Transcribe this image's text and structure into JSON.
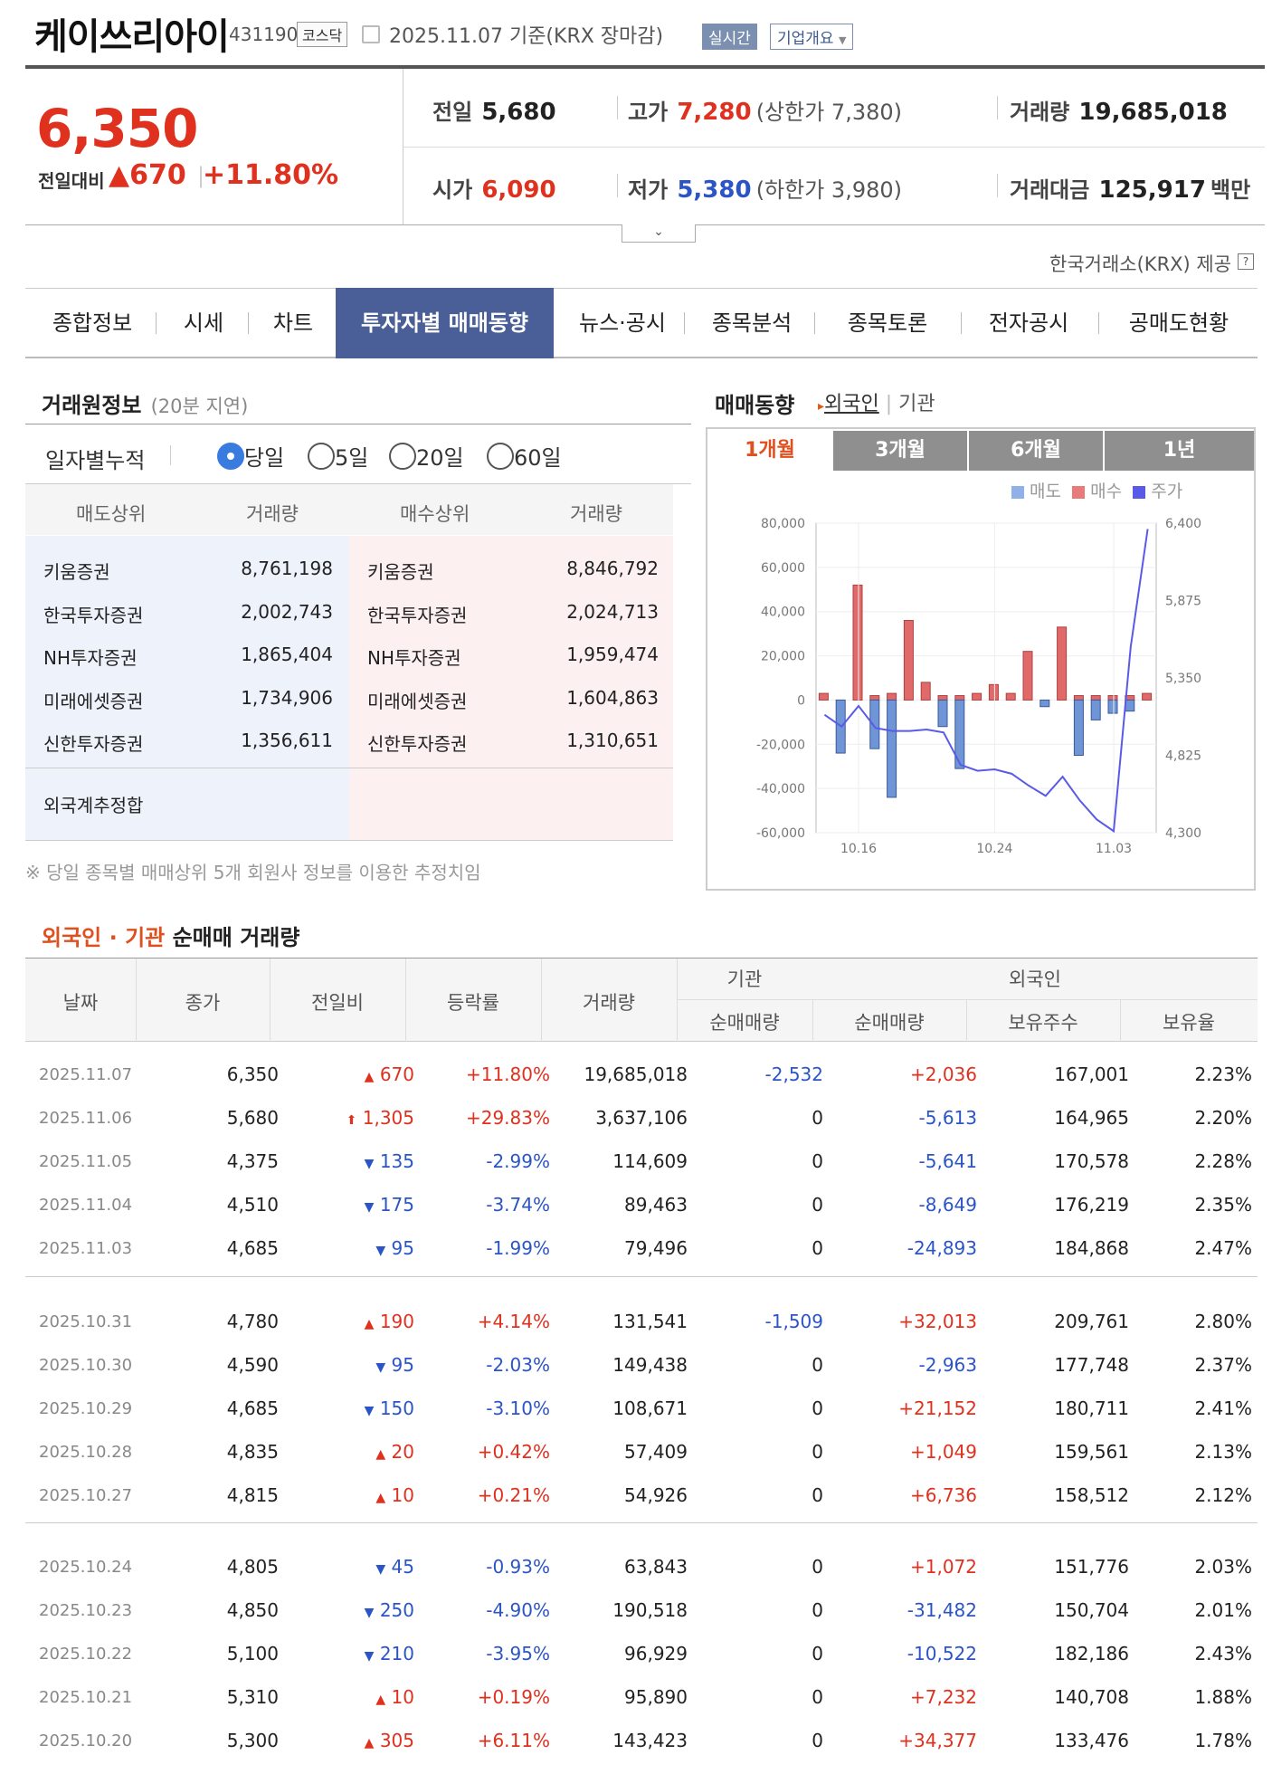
{
  "header": {
    "stock_name": "케이쓰리아이",
    "stock_code": "431190",
    "market": "코스닥",
    "date_basis": "2025.11.07 기준(KRX 장마감)",
    "realtime_label": "실시간",
    "company_label": "기업개요"
  },
  "quote": {
    "price": "6,350",
    "change_label": "전일대비",
    "change": "670",
    "change_pct": "+11.80%",
    "prev_label": "전일",
    "prev": "5,680",
    "high_label": "고가",
    "high": "7,280",
    "upper_limit": "(상한가 7,380)",
    "volume_label": "거래량",
    "volume": "19,685,018",
    "open_label": "시가",
    "open": "6,090",
    "low_label": "저가",
    "low": "5,380",
    "lower_limit": "(하한가 3,980)",
    "amount_label": "거래대금",
    "amount": "125,917",
    "amount_unit": "백만",
    "provider": "한국거래소(KRX) 제공"
  },
  "tabs": [
    "종합정보",
    "시세",
    "차트",
    "투자자별 매매동향",
    "뉴스·공시",
    "종목분석",
    "종목토론",
    "전자공시",
    "공매도현황"
  ],
  "broker": {
    "title": "거래원정보",
    "delay": "(20분 지연)",
    "period_label": "일자별누적",
    "periods": [
      "당일",
      "5일",
      "20일",
      "60일"
    ],
    "headers": [
      "매도상위",
      "거래량",
      "매수상위",
      "거래량"
    ],
    "sell": [
      {
        "name": "키움증권",
        "vol": "8,761,198"
      },
      {
        "name": "한국투자증권",
        "vol": "2,002,743"
      },
      {
        "name": "NH투자증권",
        "vol": "1,865,404"
      },
      {
        "name": "미래에셋증권",
        "vol": "1,734,906"
      },
      {
        "name": "신한투자증권",
        "vol": "1,356,611"
      }
    ],
    "buy": [
      {
        "name": "키움증권",
        "vol": "8,846,792"
      },
      {
        "name": "한국투자증권",
        "vol": "2,024,713"
      },
      {
        "name": "NH투자증권",
        "vol": "1,959,474"
      },
      {
        "name": "미래에셋증권",
        "vol": "1,604,863"
      },
      {
        "name": "신한투자증권",
        "vol": "1,310,651"
      }
    ],
    "foreign_total": "외국계추정합",
    "note": "※ 당일 종목별 매매상위 5개 회원사 정보를 이용한 추정치임"
  },
  "trend": {
    "title": "매매동향",
    "link_foreign": "외국인",
    "link_inst": "기관",
    "periods": [
      "1개월",
      "3개월",
      "6개월",
      "1년"
    ],
    "legend": [
      "매도",
      "매수",
      "주가"
    ]
  },
  "chart_data": {
    "type": "bar",
    "x_ticks": [
      "10.16",
      "10.24",
      "11.03"
    ],
    "left_ticks": [
      "80,000",
      "60,000",
      "40,000",
      "20,000",
      "0",
      "-20,000",
      "-40,000",
      "-60,000"
    ],
    "right_ticks": [
      "6,400",
      "5,875",
      "5,350",
      "4,825",
      "4,300"
    ],
    "ylim": [
      -60000,
      80000
    ],
    "y2lim": [
      4300,
      6400
    ],
    "sell": [
      0,
      -24000,
      0,
      -22000,
      -44000,
      0,
      0,
      -12000,
      -31000,
      0,
      0,
      0,
      0,
      -3000,
      0,
      -25000,
      -9000,
      -6000,
      -5000,
      0
    ],
    "buy": [
      3000,
      0,
      52000,
      2000,
      3000,
      36000,
      8000,
      2000,
      2000,
      3000,
      7000,
      3000,
      22000,
      0,
      33000,
      2000,
      2000,
      2000,
      2000,
      3000
    ],
    "price": [
      5100,
      5020,
      5160,
      5010,
      4990,
      4990,
      5000,
      4980,
      4760,
      4720,
      4730,
      4700,
      4620,
      4550,
      4680,
      4520,
      4390,
      4310,
      5560,
      6360
    ],
    "colors": {
      "sell": "#6f95d6",
      "buy": "#e06a6a",
      "price": "#5a5ae8"
    }
  },
  "net": {
    "title_red": "외국인 · 기관",
    "title_rest": "순매매 거래량",
    "headers": {
      "date": "날짜",
      "close": "종가",
      "diff": "전일비",
      "rate": "등락률",
      "volume": "거래량",
      "inst_group": "기관",
      "inst_net": "순매매량",
      "foreign_group": "외국인",
      "foreign_net": "순매매량",
      "foreign_hold": "보유주수",
      "foreign_ratio": "보유율"
    },
    "rows": [
      {
        "date": "2025.11.07",
        "close": "6,350",
        "dir": "up",
        "diff": "670",
        "rate": "+11.80%",
        "vol": "19,685,018",
        "inst": "-2,532",
        "fnet": "+2,036",
        "hold": "167,001",
        "ratio": "2.23%"
      },
      {
        "date": "2025.11.06",
        "close": "5,680",
        "dir": "upper",
        "diff": "1,305",
        "rate": "+29.83%",
        "vol": "3,637,106",
        "inst": "0",
        "fnet": "-5,613",
        "hold": "164,965",
        "ratio": "2.20%"
      },
      {
        "date": "2025.11.05",
        "close": "4,375",
        "dir": "down",
        "diff": "135",
        "rate": "-2.99%",
        "vol": "114,609",
        "inst": "0",
        "fnet": "-5,641",
        "hold": "170,578",
        "ratio": "2.28%"
      },
      {
        "date": "2025.11.04",
        "close": "4,510",
        "dir": "down",
        "diff": "175",
        "rate": "-3.74%",
        "vol": "89,463",
        "inst": "0",
        "fnet": "-8,649",
        "hold": "176,219",
        "ratio": "2.35%"
      },
      {
        "date": "2025.11.03",
        "close": "4,685",
        "dir": "down",
        "diff": "95",
        "rate": "-1.99%",
        "vol": "79,496",
        "inst": "0",
        "fnet": "-24,893",
        "hold": "184,868",
        "ratio": "2.47%"
      },
      {
        "date": "2025.10.31",
        "close": "4,780",
        "dir": "up",
        "diff": "190",
        "rate": "+4.14%",
        "vol": "131,541",
        "inst": "-1,509",
        "fnet": "+32,013",
        "hold": "209,761",
        "ratio": "2.80%"
      },
      {
        "date": "2025.10.30",
        "close": "4,590",
        "dir": "down",
        "diff": "95",
        "rate": "-2.03%",
        "vol": "149,438",
        "inst": "0",
        "fnet": "-2,963",
        "hold": "177,748",
        "ratio": "2.37%"
      },
      {
        "date": "2025.10.29",
        "close": "4,685",
        "dir": "down",
        "diff": "150",
        "rate": "-3.10%",
        "vol": "108,671",
        "inst": "0",
        "fnet": "+21,152",
        "hold": "180,711",
        "ratio": "2.41%"
      },
      {
        "date": "2025.10.28",
        "close": "4,835",
        "dir": "up",
        "diff": "20",
        "rate": "+0.42%",
        "vol": "57,409",
        "inst": "0",
        "fnet": "+1,049",
        "hold": "159,561",
        "ratio": "2.13%"
      },
      {
        "date": "2025.10.27",
        "close": "4,815",
        "dir": "up",
        "diff": "10",
        "rate": "+0.21%",
        "vol": "54,926",
        "inst": "0",
        "fnet": "+6,736",
        "hold": "158,512",
        "ratio": "2.12%"
      },
      {
        "date": "2025.10.24",
        "close": "4,805",
        "dir": "down",
        "diff": "45",
        "rate": "-0.93%",
        "vol": "63,843",
        "inst": "0",
        "fnet": "+1,072",
        "hold": "151,776",
        "ratio": "2.03%"
      },
      {
        "date": "2025.10.23",
        "close": "4,850",
        "dir": "down",
        "diff": "250",
        "rate": "-4.90%",
        "vol": "190,518",
        "inst": "0",
        "fnet": "-31,482",
        "hold": "150,704",
        "ratio": "2.01%"
      },
      {
        "date": "2025.10.22",
        "close": "5,100",
        "dir": "down",
        "diff": "210",
        "rate": "-3.95%",
        "vol": "96,929",
        "inst": "0",
        "fnet": "-10,522",
        "hold": "182,186",
        "ratio": "2.43%"
      },
      {
        "date": "2025.10.21",
        "close": "5,310",
        "dir": "up",
        "diff": "10",
        "rate": "+0.19%",
        "vol": "95,890",
        "inst": "0",
        "fnet": "+7,232",
        "hold": "140,708",
        "ratio": "1.88%"
      },
      {
        "date": "2025.10.20",
        "close": "5,300",
        "dir": "up",
        "diff": "305",
        "rate": "+6.11%",
        "vol": "143,423",
        "inst": "0",
        "fnet": "+34,377",
        "hold": "133,476",
        "ratio": "1.78%"
      }
    ]
  }
}
